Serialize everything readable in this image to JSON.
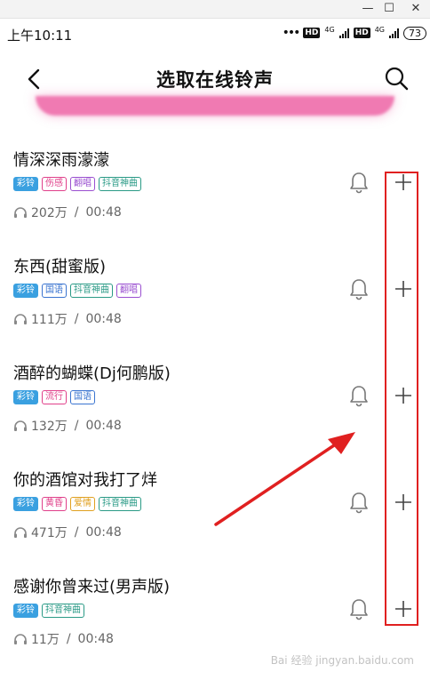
{
  "window": {
    "minimize": "—",
    "maximize": "☐",
    "close": "✕"
  },
  "status": {
    "time": "上午10:11",
    "dots": "•••",
    "hd": "HD",
    "net": "4G",
    "battery": "73"
  },
  "header": {
    "title": "选取在线铃声"
  },
  "colors": {
    "ring_solid": "#3aa0e0",
    "pink": "#e0408a",
    "purple": "#9a4fd0",
    "teal": "#2a9a86",
    "blue": "#3a74d0",
    "orange": "#e0a020",
    "highlight": "#e02020"
  },
  "songs": [
    {
      "title": "情深深雨濛濛",
      "tags": [
        "彩铃",
        "伤感",
        "翻唱",
        "抖音神曲"
      ],
      "plays": "202万",
      "duration": "00:48"
    },
    {
      "title": "东西(甜蜜版)",
      "tags": [
        "彩铃",
        "国语",
        "抖音神曲",
        "翻唱"
      ],
      "plays": "111万",
      "duration": "00:48"
    },
    {
      "title": "酒醉的蝴蝶(Dj何鹏版)",
      "tags": [
        "彩铃",
        "流行",
        "国语"
      ],
      "plays": "132万",
      "duration": "00:48"
    },
    {
      "title": "你的酒馆对我打了烊",
      "tags": [
        "彩铃",
        "黄昏",
        "爱情",
        "抖音神曲"
      ],
      "plays": "471万",
      "duration": "00:48"
    },
    {
      "title": "感谢你曾来过(男声版)",
      "tags": [
        "彩铃",
        "抖音神曲"
      ],
      "plays": "11万",
      "duration": "00:48"
    }
  ],
  "separator": "/",
  "watermark": "Bai 经验 jingyan.baidu.com"
}
